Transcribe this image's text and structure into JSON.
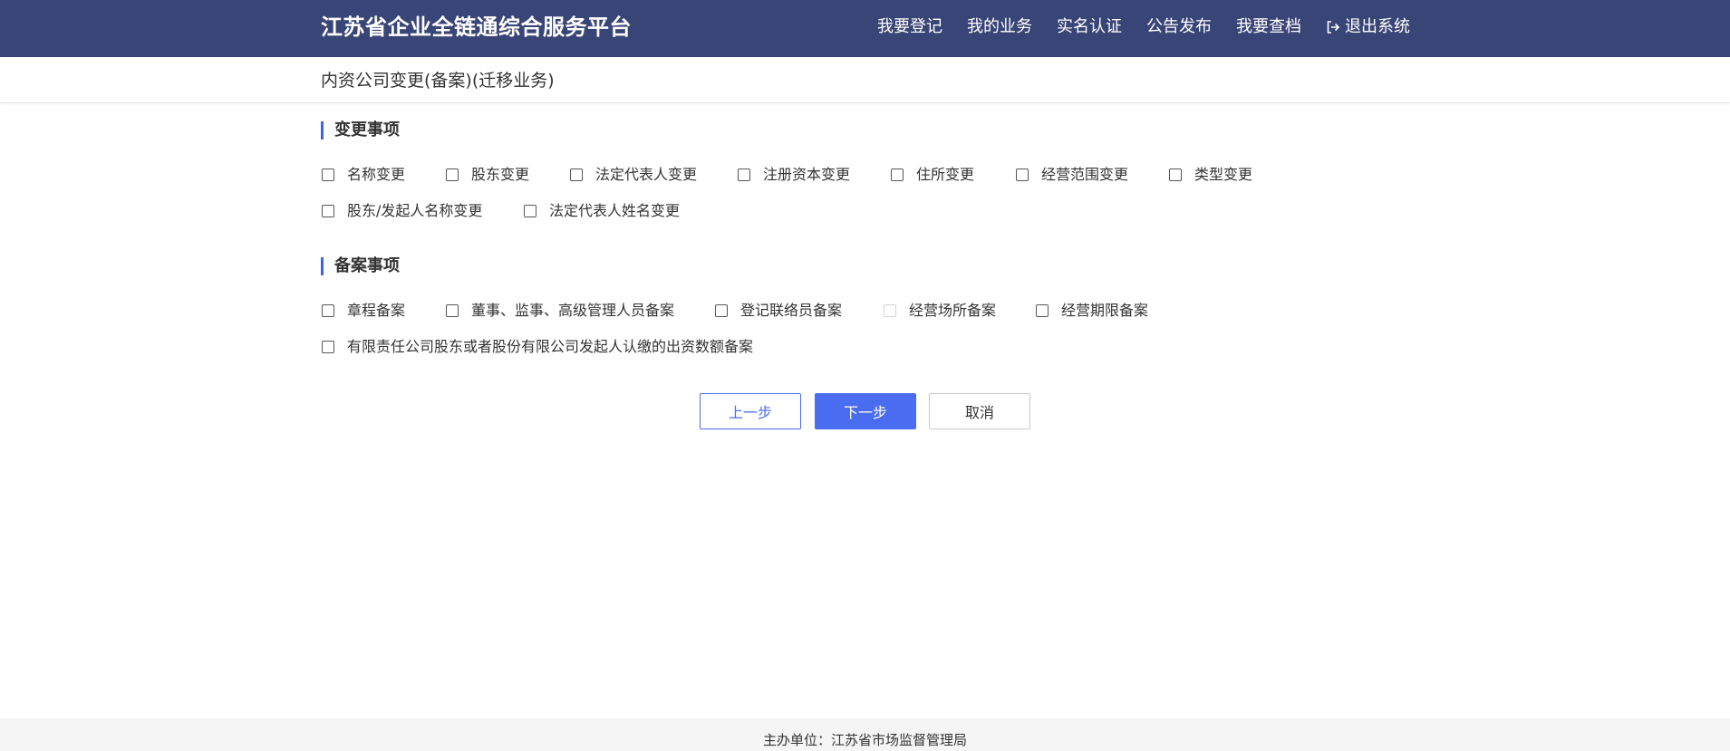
{
  "header": {
    "brand": "江苏省企业全链通综合服务平台",
    "nav": [
      "我要登记",
      "我的业务",
      "实名认证",
      "公告发布",
      "我要查档",
      "退出系统"
    ],
    "logout_icon": "logout-icon",
    "background": "#394576"
  },
  "subheader": {
    "title": "内资公司变更(备案)(迁移业务)"
  },
  "change_section": {
    "title": "变更事项",
    "options": [
      "名称变更",
      "股东变更",
      "法定代表人变更",
      "注册资本变更",
      "住所变更",
      "经营范围变更",
      "类型变更",
      "股东/发起人名称变更",
      "法定代表人姓名变更"
    ]
  },
  "filing_section": {
    "title": "备案事项",
    "options": [
      "章程备案",
      "董事、监事、高级管理人员备案",
      "登记联络员备案",
      "经营场所备案",
      "经营期限备案",
      "有限责任公司股东或者股份有限公司发起人认缴的出资数额备案"
    ],
    "disabled_option": "经营场所备案"
  },
  "buttons": {
    "prev": "上一步",
    "next": "下一步",
    "cancel": "取消",
    "primary_color": "#4a6cf0"
  },
  "footer": {
    "text": "主办单位：江苏省市场监督管理局"
  }
}
